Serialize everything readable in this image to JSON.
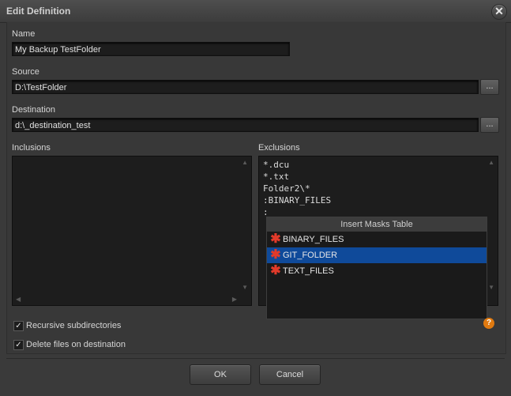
{
  "window": {
    "title": "Edit Definition",
    "close_glyph": "✕"
  },
  "name": {
    "label": "Name",
    "value": "My Backup TestFolder"
  },
  "source": {
    "label": "Source",
    "value": "D:\\TestFolder",
    "browse": "..."
  },
  "destination": {
    "label": "Destination",
    "value": "d:\\_destination_test",
    "browse": "..."
  },
  "inclusions": {
    "label": "Inclusions"
  },
  "exclusions": {
    "label": "Exclusions",
    "lines": [
      "*.dcu",
      "*.txt",
      "Folder2\\*",
      ":BINARY_FILES",
      ":"
    ]
  },
  "masks_popup": {
    "title": "Insert Masks Table",
    "items": [
      "BINARY_FILES",
      "GIT_FOLDER",
      "TEXT_FILES"
    ],
    "selected": "GIT_FOLDER",
    "icon": "asterisk-icon"
  },
  "options": {
    "recursive": {
      "label": "Recursive subdirectories",
      "checked": true
    },
    "delete": {
      "label": "Delete files on destination",
      "checked": true
    }
  },
  "help_glyph": "?",
  "buttons": {
    "ok": "OK",
    "cancel": "Cancel"
  },
  "colors": {
    "selection": "#0f4a9a",
    "icon_red": "#e23a2a",
    "help_orange": "#e07a10"
  }
}
